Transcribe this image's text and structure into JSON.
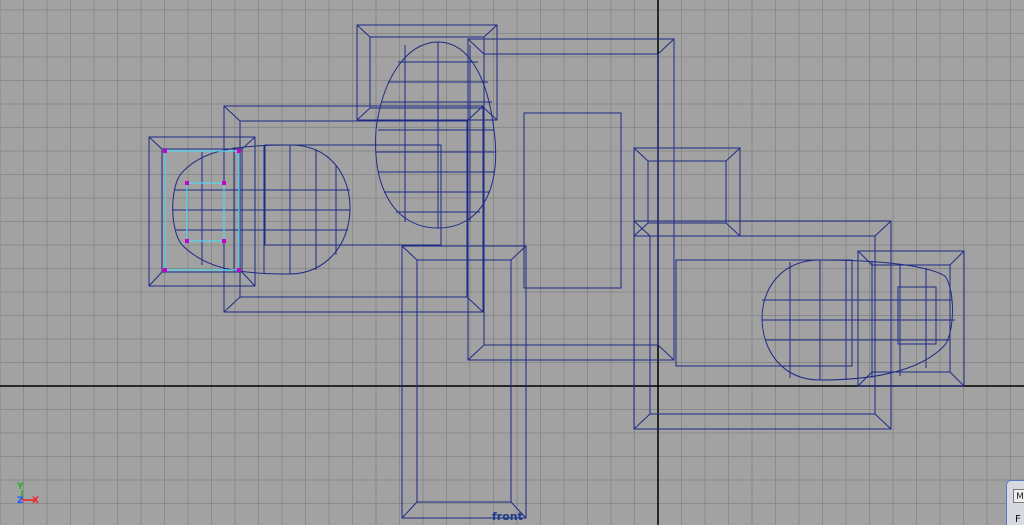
{
  "viewport": {
    "camera_name": "front",
    "axis_labels": {
      "y": "Y",
      "z": "Z",
      "x": "X"
    },
    "colors": {
      "background": "#a2a2a2",
      "grid_line": "#8a8a8a",
      "origin_axis": "#000000",
      "wireframe": "#1f2a87",
      "selected_wire": "#52d6f0",
      "selected_vertex": "#c800c8",
      "axis_y": "#22b02a",
      "axis_z": "#2255ff",
      "axis_x": "#ee2222"
    },
    "icons": [
      "axis-gizmo-icon",
      "panel-tab-icon"
    ]
  },
  "corner_panel": {
    "tab_glyph": "M",
    "text": "F"
  }
}
